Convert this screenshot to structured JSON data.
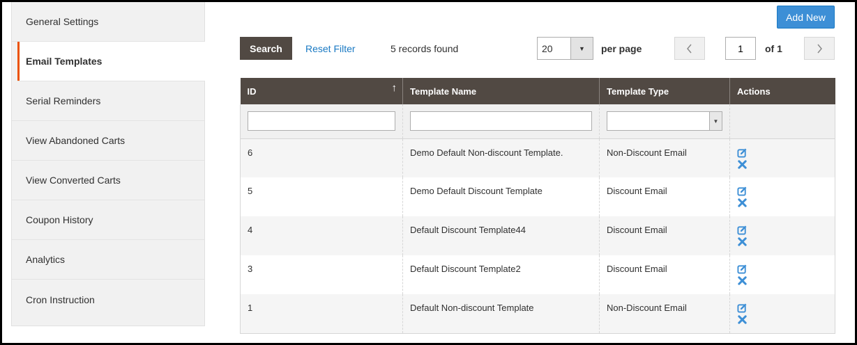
{
  "sidebar": {
    "items": [
      {
        "label": "General Settings"
      },
      {
        "label": "Email Templates"
      },
      {
        "label": "Serial Reminders"
      },
      {
        "label": "View Abandoned Carts"
      },
      {
        "label": "View Converted Carts"
      },
      {
        "label": "Coupon History"
      },
      {
        "label": "Analytics"
      },
      {
        "label": "Cron Instruction"
      }
    ],
    "active_index": 1
  },
  "toolbar": {
    "add_new_label": "Add New",
    "search_label": "Search",
    "reset_filter_label": "Reset Filter",
    "records_text": "5 records found",
    "per_page_value": "20",
    "per_page_label": "per page",
    "current_page": "1",
    "of_pages": "of 1",
    "prev_icon": "chevron-left-icon",
    "next_icon": "chevron-right-icon"
  },
  "grid": {
    "columns": [
      {
        "label": "ID"
      },
      {
        "label": "Template Name"
      },
      {
        "label": "Template Type"
      },
      {
        "label": "Actions"
      }
    ],
    "sort_icon": "sort-ascending-icon",
    "rows": [
      {
        "id": "6",
        "name": "Demo Default Non-discount Template.",
        "type": "Non-Discount Email"
      },
      {
        "id": "5",
        "name": "Demo Default Discount Template",
        "type": "Discount Email"
      },
      {
        "id": "4",
        "name": "Default Discount Template44",
        "type": "Discount Email"
      },
      {
        "id": "3",
        "name": "Default Discount Template2",
        "type": "Discount Email"
      },
      {
        "id": "1",
        "name": "Default Non-discount Template",
        "type": "Non-Discount Email"
      }
    ]
  },
  "colors": {
    "header_bg": "#514943",
    "accent_orange": "#eb5202",
    "primary_blue": "#3d8fd6",
    "link_blue": "#1979c3"
  }
}
